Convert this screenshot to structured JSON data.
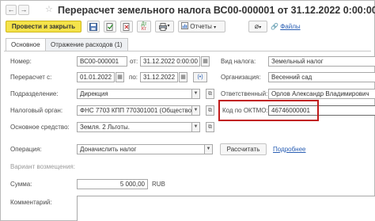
{
  "window": {
    "title": "Перерасчет земельного налога ВС00-000001 от 31.12.2022 0:00:00"
  },
  "toolbar": {
    "post_close_label": "Провести и закрыть",
    "reports_label": "Отчеты",
    "files_label": "Файлы"
  },
  "tabs": [
    {
      "label": "Основное"
    },
    {
      "label": "Отражение расходов (1)"
    }
  ],
  "form": {
    "number_label": "Номер:",
    "number_value": "ВС00-000001",
    "date_from_label": "от:",
    "date_value": "31.12.2022  0:00:00",
    "recalc_from_label": "Перерасчет с:",
    "recalc_from_value": "01.01.2022",
    "recalc_to_label": "по:",
    "recalc_to_value": "31.12.2022",
    "division_label": "Подразделение:",
    "division_value": "Дирекция",
    "tax_authority_label": "Налоговый орган:",
    "tax_authority_value": "ФНС 7703 КПП 770301001 (Общество с",
    "fixed_asset_label": "Основное средство:",
    "fixed_asset_value": "Земля. 2 Льготы.",
    "tax_type_label": "Вид налога:",
    "tax_type_value": "Земельный налог",
    "organization_label": "Организация:",
    "organization_value": "Весенний сад",
    "responsible_label": "Ответственный:",
    "responsible_value": "Орлов Александр Владимирович",
    "oktmo_label": "Код по ОКТМО:",
    "oktmo_value": "46746000001",
    "operation_label": "Операция:",
    "operation_value": "Доначислить налог",
    "calculate_label": "Рассчитать",
    "details_link": "Подробнее",
    "refund_label": "Вариант возмещения:",
    "amount_label": "Сумма:",
    "amount_value": "5 000,00",
    "currency": "RUB",
    "comment_label": "Комментарий:"
  },
  "icons": {
    "back": "arrow-left-icon",
    "forward": "arrow-right-icon",
    "favorite": "star-icon",
    "save": "save-icon",
    "post": "post-document-icon",
    "dt_kt": "dt-kt-icon",
    "print": "print-icon",
    "attach": "paperclip-icon",
    "period": "calendar-period-icon"
  },
  "colors": {
    "primary_button": "#f5e34a",
    "highlight_border": "#c11a1a",
    "link": "#2a5fb4"
  }
}
